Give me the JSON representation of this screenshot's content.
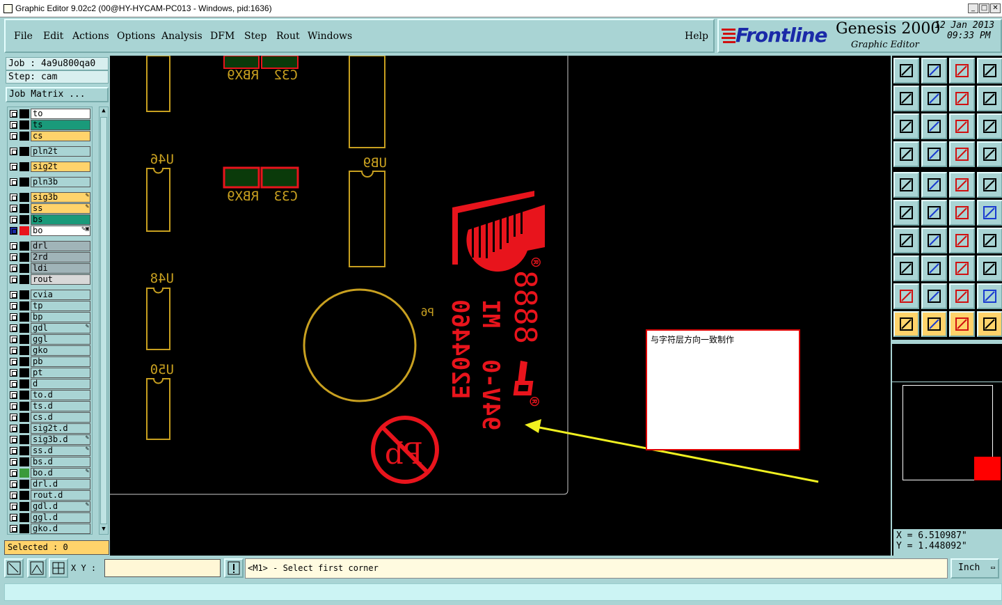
{
  "window": {
    "title": "Graphic Editor 9.02c2 (00@HY-HYCAM-PC013 - Windows, pid:1636)",
    "minimize": "_",
    "maximize": "□",
    "close": "✕"
  },
  "menu": {
    "file": "File",
    "edit": "Edit",
    "actions": "Actions",
    "options": "Options",
    "analysis": "Analysis",
    "dfm": "DFM",
    "step": "Step",
    "rout": "Rout",
    "windows": "Windows",
    "help": "Help"
  },
  "brand": {
    "logo": "Frontline",
    "product": "Genesis 2000",
    "module": "Graphic Editor",
    "date": "12 Jan 2013",
    "time": "09:33 PM"
  },
  "job": {
    "job_label": "Job : 4a9u800qa0",
    "step_label": "Step: cam",
    "matrix_button": "Job Matrix ..."
  },
  "layers": [
    {
      "name": "to",
      "color": "#ffffff"
    },
    {
      "name": "ts",
      "color": "#1a9a7a"
    },
    {
      "name": "cs",
      "color": "#ffd36b"
    },
    {
      "name": "pln2t",
      "color": "#a9d4d4"
    },
    {
      "name": "sig2t",
      "color": "#ffd36b"
    },
    {
      "name": "pln3b",
      "color": "#a9d4d4"
    },
    {
      "name": "sig3b",
      "color": "#ffd36b",
      "flag": "✎"
    },
    {
      "name": "ss",
      "color": "#ffd36b",
      "flag": "✎"
    },
    {
      "name": "bs",
      "color": "#1a9a7a"
    },
    {
      "name": "bo",
      "color": "#ffffff",
      "flag": "✎▣",
      "active": true
    },
    {
      "name": "drl",
      "color": "#a0b4b8"
    },
    {
      "name": "2rd",
      "color": "#a0b4b8"
    },
    {
      "name": "ldi",
      "color": "#a0b4b8"
    },
    {
      "name": "rout",
      "color": "#d8d8d8"
    },
    {
      "name": "cvia",
      "color": "#a9d4d4"
    },
    {
      "name": "tp",
      "color": "#a9d4d4"
    },
    {
      "name": "bp",
      "color": "#a9d4d4"
    },
    {
      "name": "gdl",
      "color": "#a9d4d4",
      "flag": "✎"
    },
    {
      "name": "ggl",
      "color": "#a9d4d4"
    },
    {
      "name": "gko",
      "color": "#a9d4d4"
    },
    {
      "name": "pb",
      "color": "#a9d4d4"
    },
    {
      "name": "pt",
      "color": "#a9d4d4"
    },
    {
      "name": "d",
      "color": "#a9d4d4"
    },
    {
      "name": "to.d",
      "color": "#a9d4d4"
    },
    {
      "name": "ts.d",
      "color": "#a9d4d4"
    },
    {
      "name": "cs.d",
      "color": "#a9d4d4"
    },
    {
      "name": "sig2t.d",
      "color": "#a9d4d4"
    },
    {
      "name": "sig3b.d",
      "color": "#a9d4d4",
      "flag": "✎"
    },
    {
      "name": "ss.d",
      "color": "#a9d4d4",
      "flag": "✎"
    },
    {
      "name": "bs.d",
      "color": "#a9d4d4"
    },
    {
      "name": "bo.d",
      "color": "#a9d4d4",
      "flag": "✎",
      "swatch": "#3a9a3a"
    },
    {
      "name": "drl.d",
      "color": "#a9d4d4"
    },
    {
      "name": "rout.d",
      "color": "#a9d4d4"
    },
    {
      "name": "gdl.d",
      "color": "#a9d4d4",
      "flag": "✎"
    },
    {
      "name": "ggl.d",
      "color": "#a9d4d4"
    },
    {
      "name": "gko.d",
      "color": "#a9d4d4"
    }
  ],
  "selected": "Selected : 0",
  "canvas": {
    "labels": {
      "c32": "C32",
      "rbx9a": "RBX9",
      "u46": "U46",
      "ub9": "UB9",
      "rbx9b": "RBX9",
      "c33": "C33",
      "u48": "U48",
      "p6": "P6",
      "u50": "U50"
    },
    "marking": {
      "line1": "E204460",
      "line2": "MI",
      "line3": "94V-0",
      "digits": "8888",
      "reg": "®",
      "pb": "Pb"
    },
    "note": "与字符层方向一致制作"
  },
  "coords": {
    "x": "X = 6.510987\"",
    "y": "Y = 1.448092\""
  },
  "bottom": {
    "xy_label": "X Y :",
    "prompt": "<M1> - Select first corner",
    "unit": "Inch",
    "unit_arrow": "▭"
  },
  "colors": {
    "panel": "#a9d4d4",
    "silk": "#e8141c",
    "component": "#c8a020",
    "arrow": "#f0f020"
  }
}
